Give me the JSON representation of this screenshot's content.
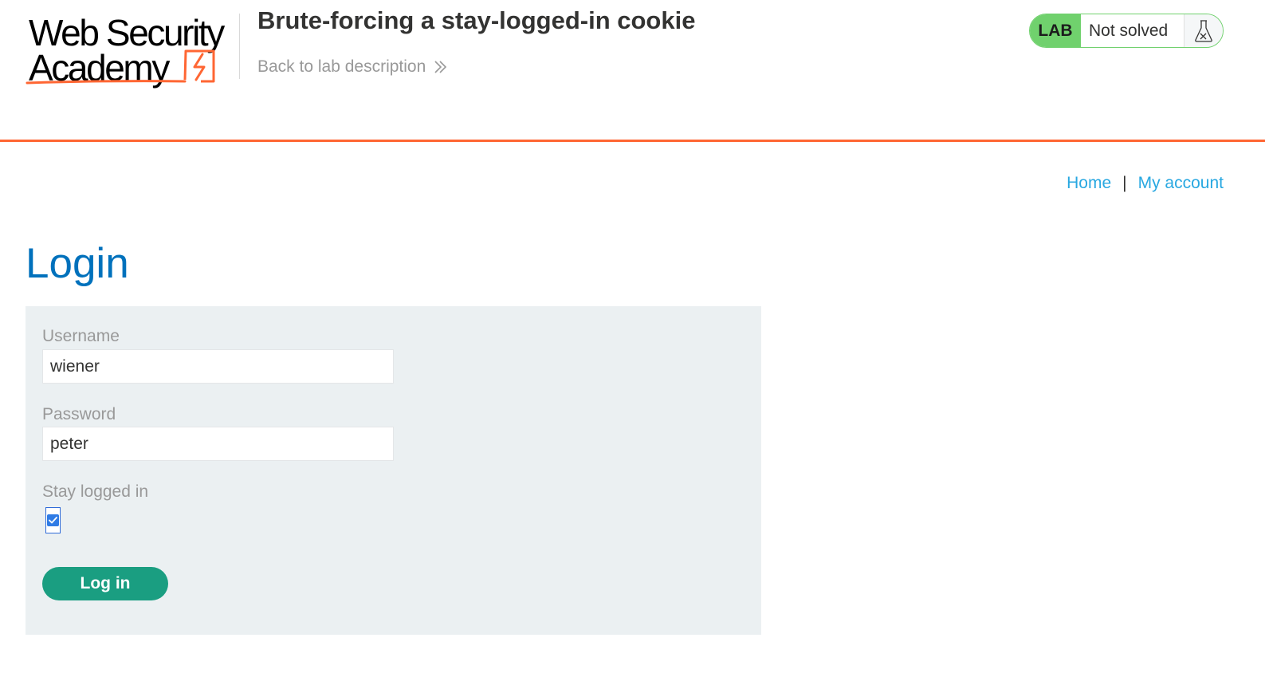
{
  "header": {
    "logo": {
      "line1": "Web Security",
      "line2": "Academy",
      "accent_color": "#ff6633",
      "icon": "lightning-bolt-icon"
    },
    "lab_title": "Brute-forcing a stay-logged-in cookie",
    "back_link": {
      "label": "Back to lab description",
      "icon": "double-chevron-right-icon"
    },
    "status": {
      "badge": "LAB",
      "text": "Not solved",
      "icon": "flask-icon",
      "badge_color": "#70d16d"
    }
  },
  "nav": {
    "home": "Home",
    "separator": "|",
    "my_account": "My account"
  },
  "page": {
    "title": "Login"
  },
  "form": {
    "username_label": "Username",
    "username_value": "wiener",
    "password_label": "Password",
    "password_value": "peter",
    "stay_logged_in_label": "Stay logged in",
    "stay_logged_in_checked": true,
    "submit_label": "Log in",
    "submit_color": "#1a9e81"
  }
}
